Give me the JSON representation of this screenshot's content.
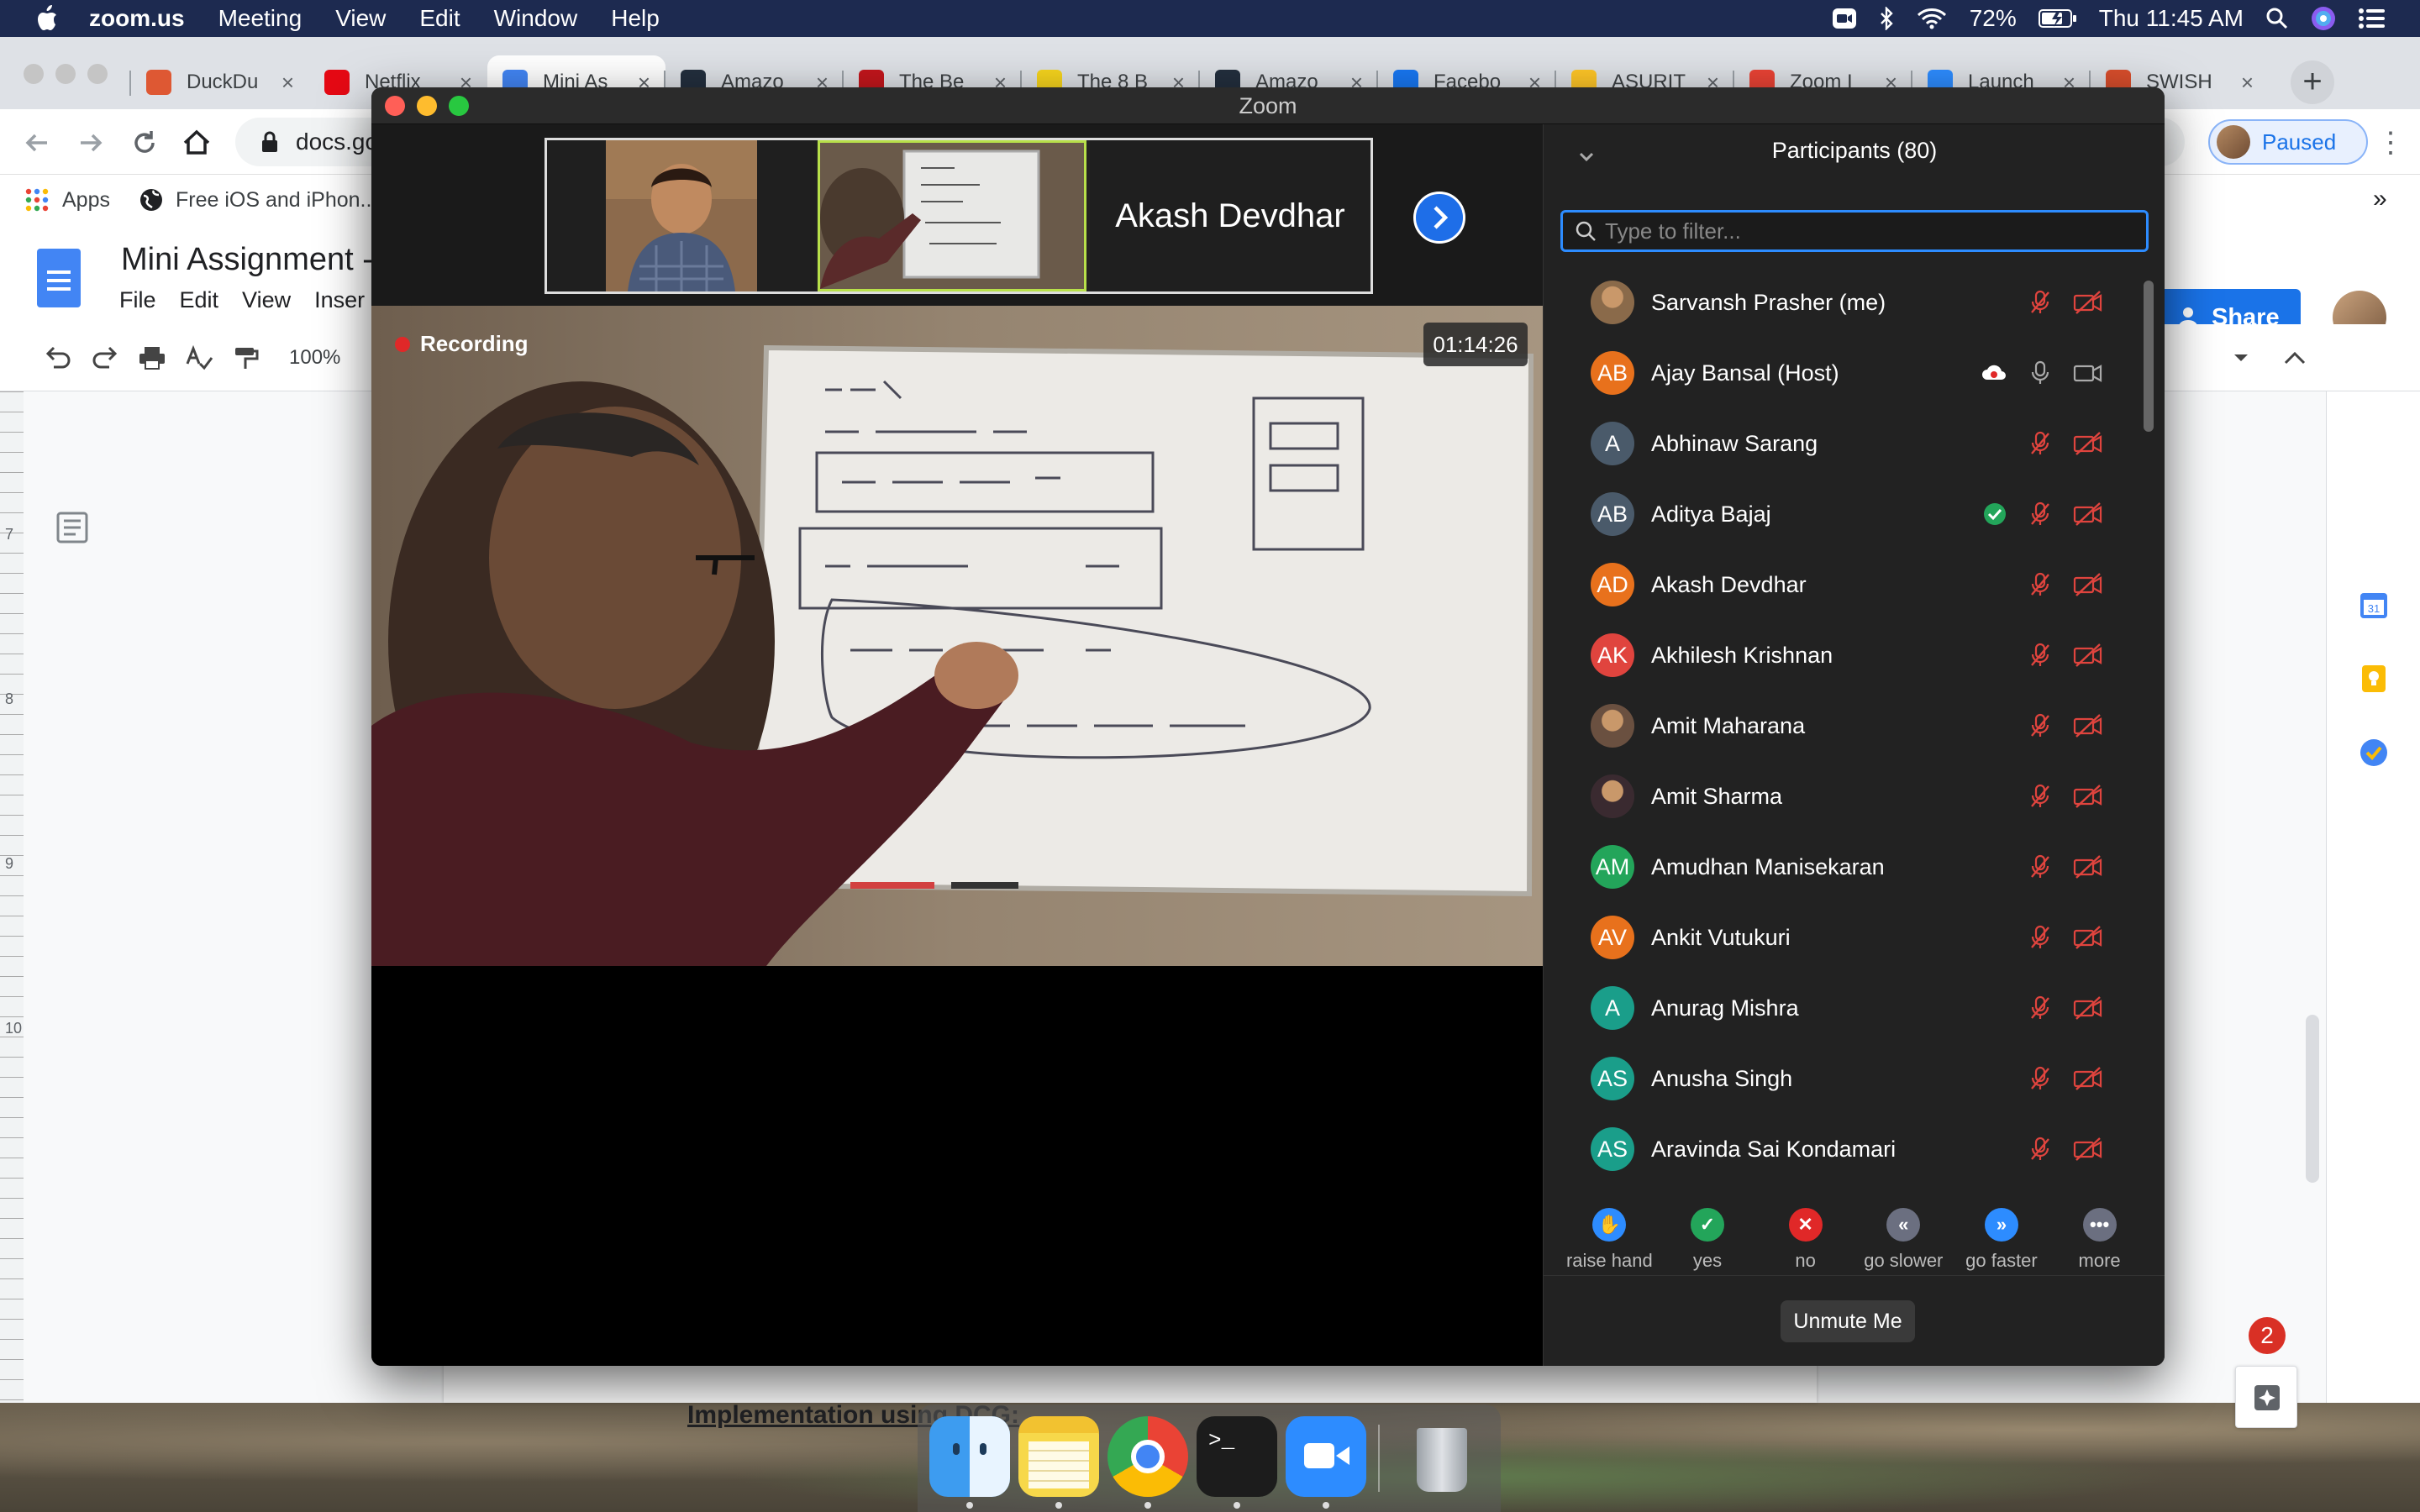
{
  "menubar": {
    "app_name": "zoom.us",
    "menus": [
      "Meeting",
      "View",
      "Edit",
      "Window",
      "Help"
    ],
    "battery": "72%",
    "clock": "Thu 11:45 AM"
  },
  "browser": {
    "tabs": [
      {
        "title": "DuckDu",
        "color": "#de5833"
      },
      {
        "title": "Netflix",
        "color": "#e50914"
      },
      {
        "title": "Mini As",
        "color": "#4285f4"
      },
      {
        "title": "Amazo",
        "color": "#232f3e"
      },
      {
        "title": "The Be",
        "color": "#c4161c"
      },
      {
        "title": "The 8 B",
        "color": "#f7d51d"
      },
      {
        "title": "Amazo",
        "color": "#232f3e"
      },
      {
        "title": "Facebo",
        "color": "#1877f2"
      },
      {
        "title": "ASURIT",
        "color": "#ffc627"
      },
      {
        "title": "Zoom I",
        "color": "#ea4335"
      },
      {
        "title": "Launch",
        "color": "#2d8cff"
      },
      {
        "title": "SWISH",
        "color": "#d94e2c"
      }
    ],
    "url": "docs.gc",
    "profile_status": "Paused",
    "bookmarks": [
      "Apps",
      "Free iOS and iPhon..."
    ]
  },
  "docs": {
    "title": "Mini Assignment -",
    "menu": [
      "File",
      "Edit",
      "View",
      "Inser"
    ],
    "zoom": "100%",
    "share_label": "Share",
    "ruler_numbers": [
      "7",
      "8",
      "9",
      "10"
    ],
    "heading": "Implementation using DCG:",
    "notification_count": "2"
  },
  "zoom": {
    "window_title": "Zoom",
    "gallery_name": "Akash Devdhar",
    "recording_label": "Recording",
    "timer": "01:14:26",
    "participants_title": "Participants (80)",
    "filter_placeholder": "Type to filter...",
    "participants": [
      {
        "name": "Sarvansh Prasher (me)",
        "initials": "",
        "color": "#8a6a4a",
        "photo": true,
        "status": ""
      },
      {
        "name": "Ajay Bansal (Host)",
        "initials": "AB",
        "color": "#e8711c",
        "photo": false,
        "status": "host"
      },
      {
        "name": "Abhinaw Sarang",
        "initials": "A",
        "color": "#4a5a6a",
        "photo": false,
        "status": ""
      },
      {
        "name": "Aditya Bajaj",
        "initials": "AB",
        "color": "#4a5a6a",
        "photo": false,
        "status": "yes"
      },
      {
        "name": "Akash Devdhar",
        "initials": "AD",
        "color": "#e8711c",
        "photo": false,
        "status": ""
      },
      {
        "name": "Akhilesh Krishnan",
        "initials": "AK",
        "color": "#e0443e",
        "photo": false,
        "status": ""
      },
      {
        "name": "Amit Maharana",
        "initials": "",
        "color": "#6a5040",
        "photo": true,
        "status": ""
      },
      {
        "name": "Amit Sharma",
        "initials": "",
        "color": "#3a2a30",
        "photo": true,
        "status": ""
      },
      {
        "name": "Amudhan Manisekaran",
        "initials": "AM",
        "color": "#23a55a",
        "photo": false,
        "status": ""
      },
      {
        "name": "Ankit Vutukuri",
        "initials": "AV",
        "color": "#e8711c",
        "photo": false,
        "status": ""
      },
      {
        "name": "Anurag Mishra",
        "initials": "A",
        "color": "#1a9e8a",
        "photo": false,
        "status": ""
      },
      {
        "name": "Anusha Singh",
        "initials": "AS",
        "color": "#1a9e8a",
        "photo": false,
        "status": ""
      },
      {
        "name": "Aravinda Sai Kondamari",
        "initials": "AS",
        "color": "#1a9e8a",
        "photo": false,
        "status": ""
      }
    ],
    "reactions": [
      {
        "label": "raise hand",
        "color": "#2d8cff",
        "glyph": "✋"
      },
      {
        "label": "yes",
        "color": "#23a55a",
        "glyph": "✓"
      },
      {
        "label": "no",
        "color": "#e02828",
        "glyph": "✕"
      },
      {
        "label": "go slower",
        "color": "#6b6f80",
        "glyph": "«"
      },
      {
        "label": "go faster",
        "color": "#2d8cff",
        "glyph": "»"
      },
      {
        "label": "more",
        "color": "#6b6f80",
        "glyph": "•••"
      }
    ],
    "unmute_label": "Unmute Me"
  },
  "dock": {
    "apps": [
      {
        "name": "Finder",
        "color": "#3d9cf0"
      },
      {
        "name": "Notes",
        "color": "#f7d84a"
      },
      {
        "name": "Chrome",
        "color": "#ea4335"
      },
      {
        "name": "Terminal",
        "color": "#1c1c1c"
      },
      {
        "name": "Zoom",
        "color": "#2d8cff"
      },
      {
        "name": "Trash",
        "color": "#b8bcc2"
      }
    ]
  }
}
